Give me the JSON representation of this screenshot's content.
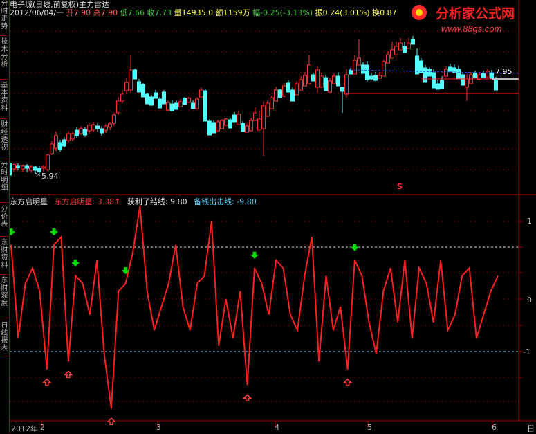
{
  "header": {
    "security": "电子城(日线,前复权)主力雷达",
    "date": "2012/06/04/一",
    "open": "开7.90",
    "high": "高7.90",
    "low": "低7.66",
    "close": "收7.73",
    "volume": "量14935.0",
    "amount": "额1159万",
    "change": "幅-0.25(-3.13%)",
    "amplitude": "振0.24(3.01%)",
    "turnover": "换0.87"
  },
  "logo": {
    "name": "分析家公式网",
    "url": "www.88gs.com"
  },
  "sidebar_tabs": [
    "分时走势",
    "技术分析",
    "基本资料",
    "财经透视",
    "分时明细",
    "分价表",
    "东财资料",
    "东财深度",
    "日线报表"
  ],
  "price_panel": {
    "low_label": "5.94",
    "last_price_label": "7.95",
    "s_marker": "S"
  },
  "indicator": {
    "name": "东方启明星",
    "series_label": "东方启明星: 3.38",
    "profit_label": "获利了结线: 9.80",
    "buy_label": "备钱出击线: -9.80"
  },
  "y_axis_labels": [
    "1",
    "0",
    "-1"
  ],
  "x_axis_labels": [
    "2012年",
    "2",
    "3",
    "4",
    "5",
    "6"
  ],
  "bottom_right_tab": "日",
  "colors": {
    "up": "#ff3232",
    "down": "#54ffff",
    "signal_line": "#ff2020",
    "buy_arrow": "#ff4040",
    "sell_arrow": "#00e000",
    "dashed": "#e0e0e0",
    "blue_level": "#2a4bff"
  },
  "chart_data": {
    "type": "line",
    "series": [
      {
        "name": "东方启明星",
        "values": [
          0.7,
          -0.5,
          0.2,
          0.4,
          0.1,
          -0.9,
          0.7,
          0.8,
          -0.8,
          0.3,
          0.2,
          -0.2,
          0.5,
          -0.7,
          -1.4,
          0.1,
          0.2,
          0.6,
          1.2,
          0.1,
          -0.4,
          -0.1,
          0.2,
          0.7,
          -0.1,
          -0.4,
          0.2,
          0.3,
          1.0,
          -0.6,
          0.0,
          -0.5,
          0.1,
          -1.1,
          0.4,
          0.2,
          -0.2,
          0.5,
          0.4,
          -0.2,
          -0.4,
          0.3,
          0.8,
          -0.8,
          0.3,
          -0.4,
          -0.1,
          -0.9,
          0.5,
          0.3,
          -0.3,
          -0.7,
          0.1,
          0.4,
          -0.3,
          0.5,
          -0.5,
          0.4,
          0.2,
          -0.3,
          0.5,
          -0.4,
          -0.2,
          0.3,
          0.4,
          -0.5,
          -0.2,
          0.1,
          0.3
        ]
      }
    ],
    "reference_lines": {
      "profit": 9.8,
      "buy": -9.8
    },
    "buy_signals_idx": [
      5,
      8,
      14,
      33,
      47
    ],
    "sell_signals_idx": [
      0,
      6,
      9,
      16,
      34,
      48
    ],
    "ylim": [
      -1.5,
      1.5
    ]
  }
}
